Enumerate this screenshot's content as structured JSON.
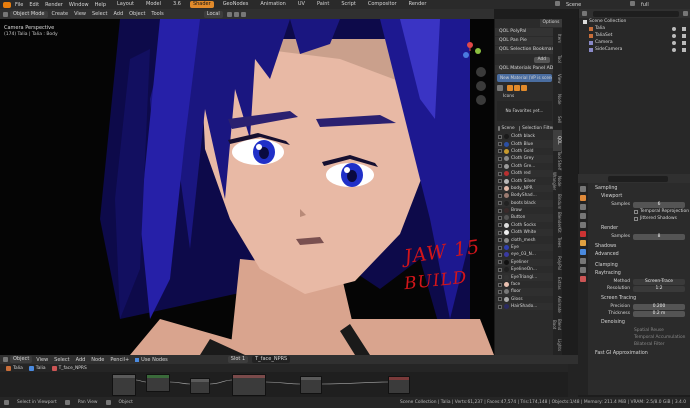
{
  "top_menu": {
    "items": [
      "File",
      "Edit",
      "Render",
      "Window",
      "Help"
    ],
    "workspaces": [
      "Layout",
      "Model",
      "3.6",
      "Shader",
      "GeoNodes",
      "Animation",
      "UV",
      "Paint",
      "Script",
      "Compositor",
      "Render"
    ],
    "active_workspace": "Shader",
    "scene_label": "Scene",
    "view_layer_label": "full"
  },
  "viewport_header": {
    "mode": "Object Mode",
    "menus": [
      "Create",
      "View",
      "Select",
      "Add",
      "Object",
      "Tools"
    ],
    "orientation": "Local"
  },
  "viewport": {
    "overlay_title": "Camera Perspective",
    "overlay_subtitle": "(174) Talia | Talia : Body",
    "annotation_line1": "JAW 15",
    "annotation_line2": "BUILD"
  },
  "npanel": {
    "options_label": "Options",
    "panels": [
      "QOL PolyPal",
      "QOL Pan Pie",
      "QOL Selection Bookmarks"
    ],
    "add_button": "Add",
    "materials_panel": "QOL Materials Panel ADV",
    "new_material_label": "New Material (VP is scene)",
    "icons_label": "Icons",
    "favorites_empty": "No Favorites yet...",
    "filter_scene": "Scene",
    "filter_selection": "Selection Filter",
    "materials": [
      "Cloth black",
      "Cloth Blue",
      "Cloth Gold",
      "Cloth Grey",
      "Cloth Gre...",
      "Cloth red",
      "Cloth Silver",
      "body_NPR",
      "BodyShad...",
      "boots black",
      "Brow",
      "Button",
      "Cloth Socks",
      "Cloth White",
      "cloth_mesh",
      "Eye",
      "eye_03_N...",
      "Eyeliner",
      "EyeIineOn...",
      "EyeTriangl...",
      "face",
      "floor",
      "Gloss",
      "HairShado..."
    ],
    "material_colors": [
      "#1a1a1a",
      "#2b4fa3",
      "#c89a2d",
      "#8a8a8a",
      "#9a9a9a",
      "#b83030",
      "#b8b8b8",
      "#e2b9a8",
      "#9a7a70",
      "#222222",
      "#3a2a2a",
      "#555555",
      "#dddddd",
      "#eeeeee",
      "#888888",
      "#3040b0",
      "#3a3aa0",
      "#111111",
      "#202020",
      "#333333",
      "#e8c0b0",
      "#777777",
      "#aaaaaa",
      "#2a2a60"
    ],
    "side_tabs": [
      "Item",
      "Tool",
      "View",
      "Node",
      "Sell",
      "QOL",
      "Tool Shelf",
      "Node Wrangler",
      "Bindum",
      "BlenderKit",
      "Trees",
      "PolyPal",
      "Extras",
      "Animate",
      "Blend Boot",
      "Lights"
    ]
  },
  "outliner": {
    "title": "Scene Collection",
    "rows": [
      "Talia",
      "TaliaSet",
      "Camera",
      "SideCamera"
    ],
    "row_colors": [
      "#c86e3a",
      "#c86e3a",
      "#8a8ac8",
      "#8a8ac8"
    ]
  },
  "properties": {
    "sections": {
      "sampling": "Sampling",
      "viewport": "Viewport",
      "render": "Render",
      "shadows": "Shadows",
      "advanced": "Advanced",
      "clamping": "Clamping",
      "raytracing": "Raytracing",
      "screen_tracing": "Screen Tracing",
      "denoising": "Denoising",
      "fast_gi": "Fast GI Approximation"
    },
    "fields": {
      "samples_label": "Samples",
      "viewport_samples": "6",
      "temporal_reprojection": "Temporal Reprojection",
      "jittered_shadows": "Jittered Shadows",
      "render_samples_label": "Samples",
      "render_samples": "8",
      "method_label": "Method",
      "method_value": "Screen-Trace",
      "resolution_label": "Resolution",
      "resolution_value": "1:2",
      "precision_label": "Precision",
      "precision_value": "0.200",
      "thickness_label": "Thickness",
      "thickness_value": "0.2 m",
      "spatial_reuse": "Spatial Reuse",
      "temporal_accumulation": "Temporal Accumulation",
      "bilateral_filter": "Bilateral Filter"
    }
  },
  "node_editor": {
    "editor_type": "Object",
    "menus": [
      "View",
      "Select",
      "Add",
      "Node",
      "Pencil+"
    ],
    "use_nodes": "Use Nodes",
    "slot": "Slot 1",
    "material": "T_face_NPRS",
    "breadcrumb": [
      "Talia",
      "Talia",
      "T_face_NPRS"
    ]
  },
  "status": {
    "left": [
      "Select in Viewport",
      "Pan View",
      "Object"
    ],
    "right": "Scene Collection | Talia | Verts:61,237 | Faces:47,574 | Tris:174,148 | Objects:1/48 | Memory: 211.4 MiB | VRAM: 2.5/8.0 GiB | 3.4.0"
  }
}
